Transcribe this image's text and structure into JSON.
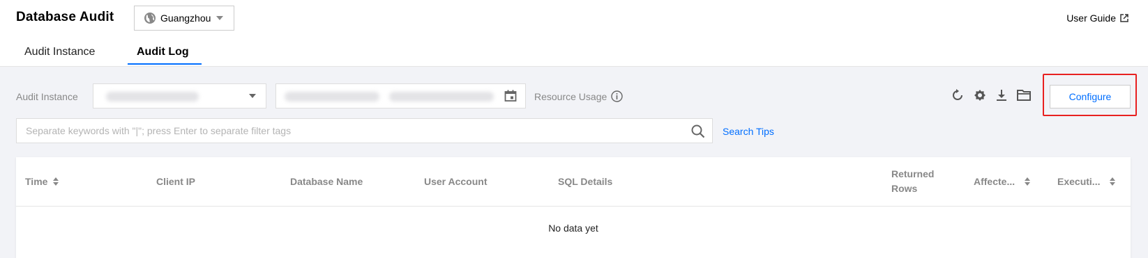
{
  "app": {
    "title": "Database Audit"
  },
  "region": {
    "selected": "Guangzhou"
  },
  "header": {
    "user_guide": "User Guide"
  },
  "tabs": [
    {
      "label": "Audit Instance",
      "active": false
    },
    {
      "label": "Audit Log",
      "active": true
    }
  ],
  "filters": {
    "instance_label": "Audit Instance",
    "resource_usage_label": "Resource Usage"
  },
  "toolbar": {
    "icons": [
      "refresh-icon",
      "settings-icon",
      "download-icon",
      "folder-icon"
    ],
    "configure_label": "Configure"
  },
  "search": {
    "placeholder": "Separate keywords with \"|\"; press Enter to separate filter tags",
    "value": "",
    "tips_label": "Search Tips"
  },
  "table": {
    "columns": [
      {
        "label": "Time",
        "sortable": true
      },
      {
        "label": "Client IP",
        "sortable": false
      },
      {
        "label": "Database Name",
        "sortable": false
      },
      {
        "label": "User Account",
        "sortable": false
      },
      {
        "label": "SQL Details",
        "sortable": false
      },
      {
        "label": "Returned Rows",
        "sortable": false
      },
      {
        "label": "Affecte...",
        "sortable": true
      },
      {
        "label": "Executi...",
        "sortable": true
      }
    ],
    "empty_text": "No data yet"
  },
  "colors": {
    "accent": "#006eff",
    "highlight": "#e82020",
    "background": "#f2f3f7"
  }
}
